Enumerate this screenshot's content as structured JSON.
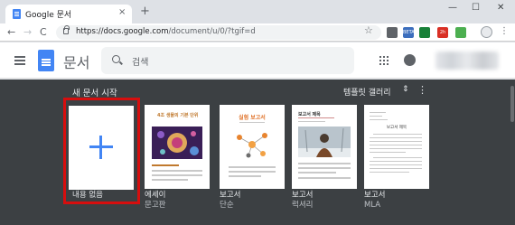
{
  "browser": {
    "tab_title": "Google 문서",
    "tab_close": "×",
    "new_tab": "+",
    "window_controls": [
      "—",
      "☐",
      "✕"
    ],
    "nav": {
      "back": "←",
      "forward": "→",
      "reload": "C"
    },
    "url_main": "https://docs.google.com",
    "url_rest": "/document/u/0/?tgif=d",
    "star": "☆",
    "extensions": [
      {
        "name": "extension-1-icon",
        "color": "#5f6368",
        "label": ""
      },
      {
        "name": "extension-2-icon",
        "color": "#3c6ebd",
        "label": "BETA"
      },
      {
        "name": "extension-3-icon",
        "color": "#188038",
        "label": ""
      },
      {
        "name": "extension-4-icon",
        "color": "#d93025",
        "label": "2h"
      },
      {
        "name": "extension-5-icon",
        "color": "#4caf50",
        "label": ""
      }
    ],
    "menu": "⋮"
  },
  "docs": {
    "app_name": "문서",
    "search_placeholder": "검색",
    "accent": "#4285f4"
  },
  "gallery": {
    "title": "새 문서 시작",
    "template_gallery_label": "템플릿 갤러리",
    "expand_icon": "⇕",
    "more": "⋮",
    "highlight_color": "#d60e0e",
    "cards": [
      {
        "id": "blank",
        "label": "내용 없음",
        "sub": ""
      },
      {
        "id": "essay",
        "label": "에세이",
        "sub": "문고판",
        "thumb_title": "4조 생물의 기본 단위"
      },
      {
        "id": "report-simple",
        "label": "보고서",
        "sub": "단순",
        "thumb_title": "실험 보고서"
      },
      {
        "id": "report-luxury",
        "label": "보고서",
        "sub": "럭셔리",
        "thumb_title": "보고서 제목"
      },
      {
        "id": "report-mla",
        "label": "보고서",
        "sub": "MLA",
        "thumb_title": "보고서 제목"
      }
    ]
  }
}
